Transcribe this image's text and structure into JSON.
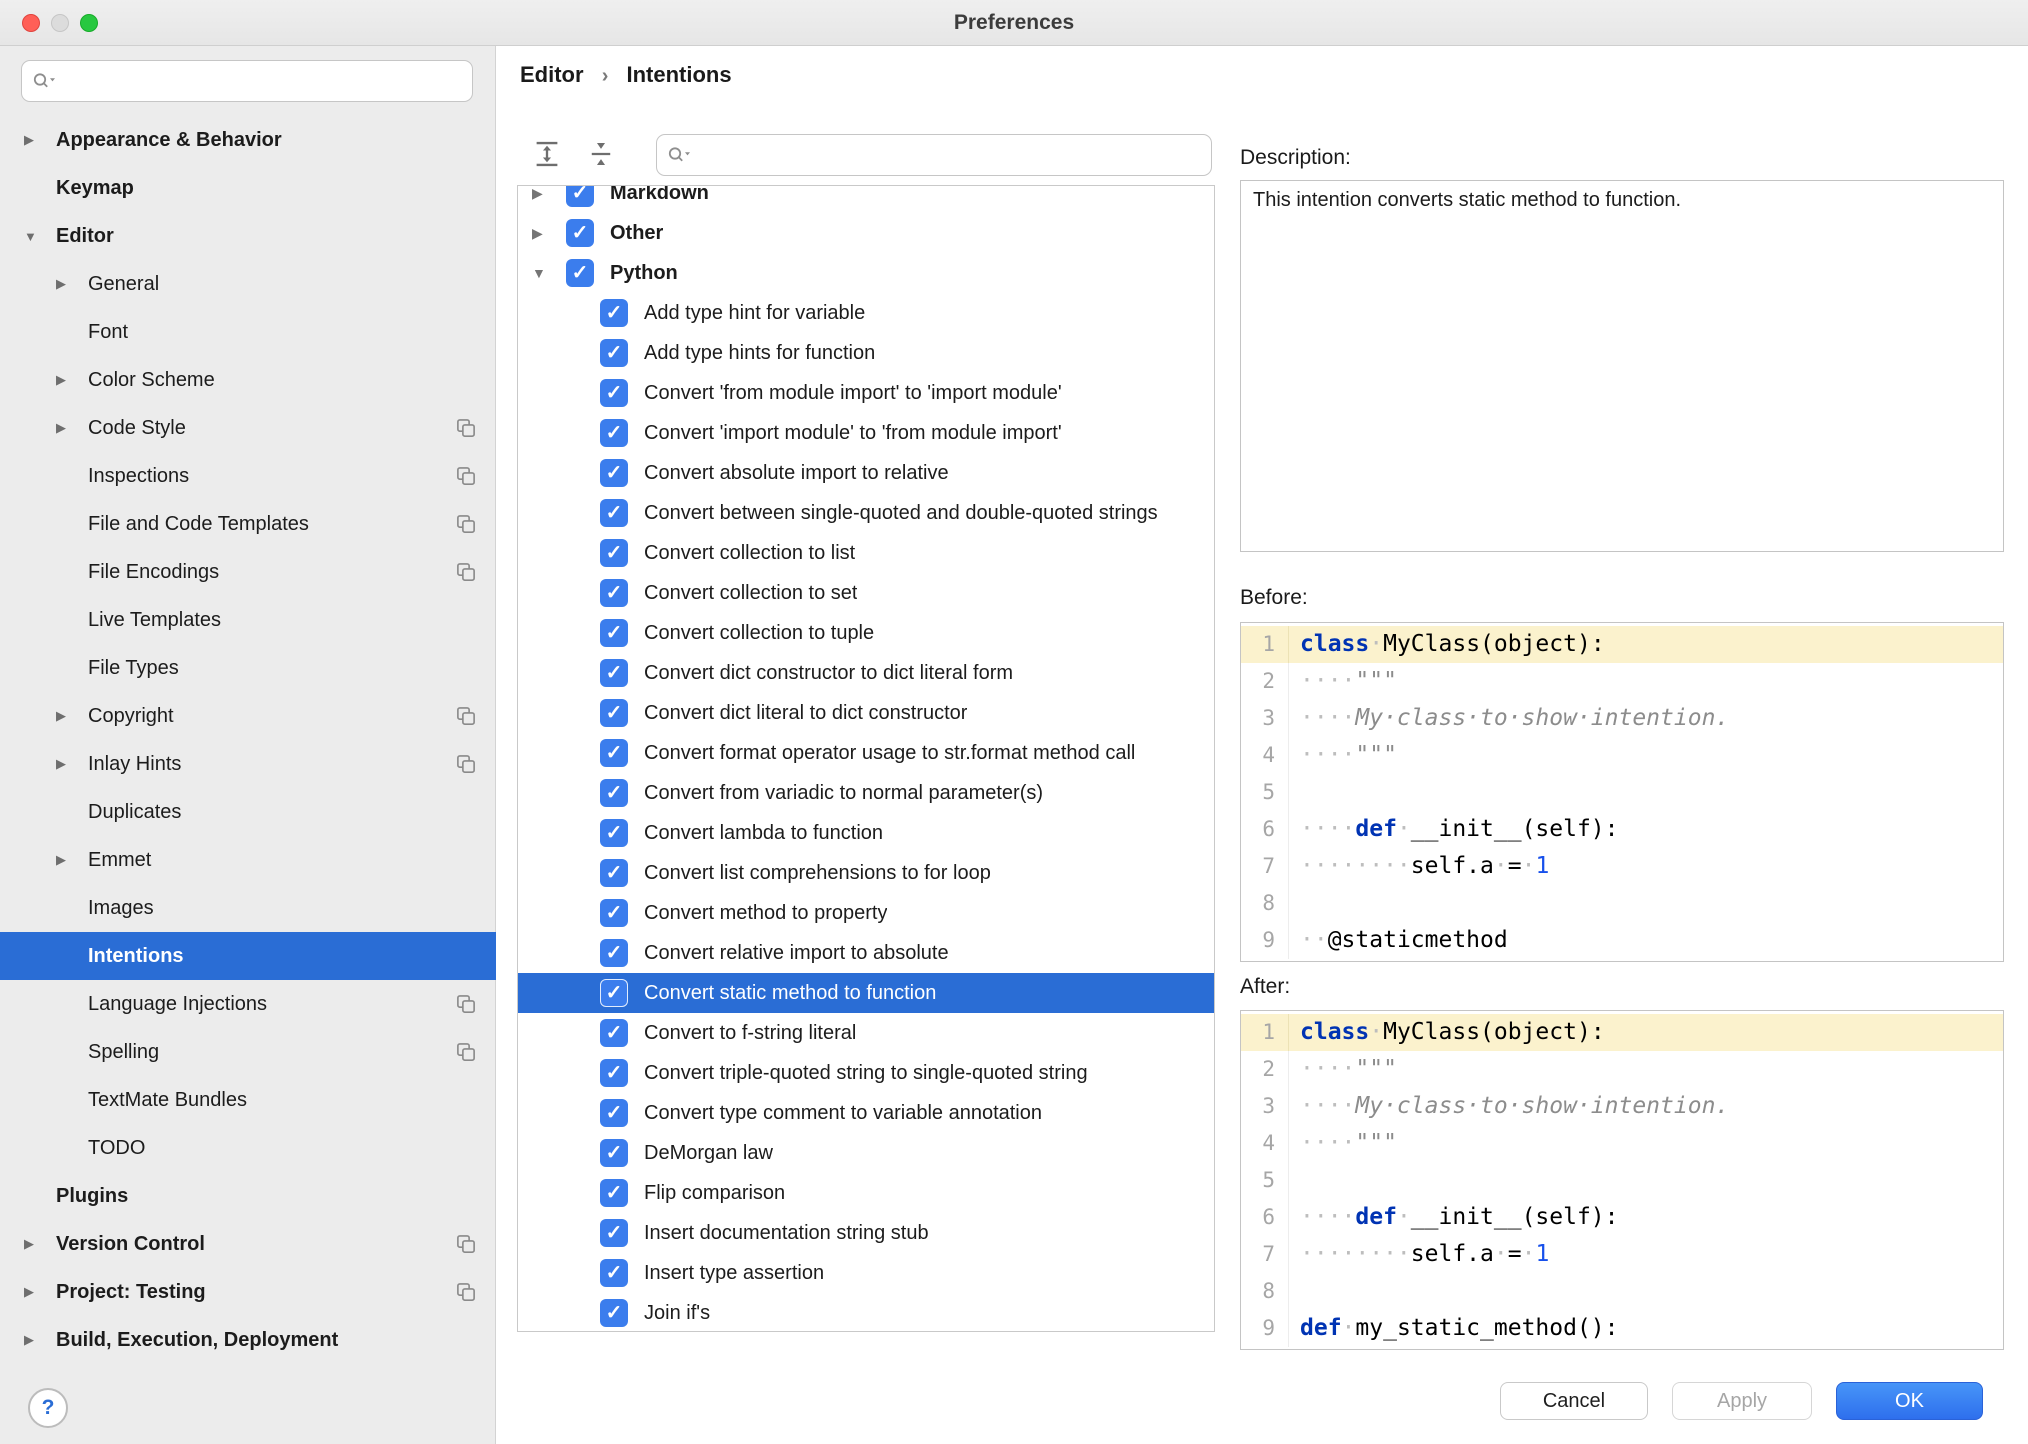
{
  "window": {
    "title": "Preferences"
  },
  "colors": {
    "selection_blue": "#2a6dd5",
    "checkbox_blue": "#3b7ded",
    "ok_button_blue": "#3574f0",
    "line_highlight_yellow": "#fbf2cd",
    "sidebar_gray": "#ececec"
  },
  "sidebar": {
    "search_placeholder": "",
    "items": [
      {
        "label": "Appearance & Behavior",
        "level": 0,
        "bold": true,
        "chevron": "right"
      },
      {
        "label": "Keymap",
        "level": 0,
        "bold": true
      },
      {
        "label": "Editor",
        "level": 0,
        "bold": true,
        "chevron": "down"
      },
      {
        "label": "General",
        "level": 1,
        "chevron": "right"
      },
      {
        "label": "Font",
        "level": 1
      },
      {
        "label": "Color Scheme",
        "level": 1,
        "chevron": "right"
      },
      {
        "label": "Code Style",
        "level": 1,
        "chevron": "right",
        "badge": true
      },
      {
        "label": "Inspections",
        "level": 1,
        "badge": true
      },
      {
        "label": "File and Code Templates",
        "level": 1,
        "badge": true
      },
      {
        "label": "File Encodings",
        "level": 1,
        "badge": true
      },
      {
        "label": "Live Templates",
        "level": 1
      },
      {
        "label": "File Types",
        "level": 1
      },
      {
        "label": "Copyright",
        "level": 1,
        "chevron": "right",
        "badge": true
      },
      {
        "label": "Inlay Hints",
        "level": 1,
        "chevron": "right",
        "badge": true
      },
      {
        "label": "Duplicates",
        "level": 1
      },
      {
        "label": "Emmet",
        "level": 1,
        "chevron": "right"
      },
      {
        "label": "Images",
        "level": 1
      },
      {
        "label": "Intentions",
        "level": 1,
        "selected": true
      },
      {
        "label": "Language Injections",
        "level": 1,
        "badge": true
      },
      {
        "label": "Spelling",
        "level": 1,
        "badge": true
      },
      {
        "label": "TextMate Bundles",
        "level": 1
      },
      {
        "label": "TODO",
        "level": 1
      },
      {
        "label": "Plugins",
        "level": 0,
        "bold": true
      },
      {
        "label": "Version Control",
        "level": 0,
        "bold": true,
        "chevron": "right",
        "badge": true
      },
      {
        "label": "Project: Testing",
        "level": 0,
        "bold": true,
        "chevron": "right",
        "badge": true
      },
      {
        "label": "Build, Execution, Deployment",
        "level": 0,
        "bold": true,
        "chevron": "right"
      }
    ]
  },
  "breadcrumb": {
    "parts": [
      "Editor",
      "Intentions"
    ],
    "separator": "›"
  },
  "tree_search_placeholder": "",
  "intentions_tree": {
    "rows": [
      {
        "label": "Markdown",
        "group": true,
        "chevron": "right",
        "checked": true,
        "clipped_top": true
      },
      {
        "label": "Other",
        "group": true,
        "chevron": "right",
        "checked": true
      },
      {
        "label": "Python",
        "group": true,
        "chevron": "down",
        "checked": true
      },
      {
        "label": "Add type hint for variable",
        "checked": true
      },
      {
        "label": "Add type hints for function",
        "checked": true
      },
      {
        "label": "Convert 'from module import' to 'import module'",
        "checked": true
      },
      {
        "label": "Convert 'import module' to 'from module import'",
        "checked": true
      },
      {
        "label": "Convert absolute import to relative",
        "checked": true
      },
      {
        "label": "Convert between single-quoted and double-quoted strings",
        "checked": true
      },
      {
        "label": "Convert collection to list",
        "checked": true
      },
      {
        "label": "Convert collection to set",
        "checked": true
      },
      {
        "label": "Convert collection to tuple",
        "checked": true
      },
      {
        "label": "Convert dict constructor to dict literal form",
        "checked": true
      },
      {
        "label": "Convert dict literal to dict constructor",
        "checked": true
      },
      {
        "label": "Convert format operator usage to str.format method call",
        "checked": true
      },
      {
        "label": "Convert from variadic to normal parameter(s)",
        "checked": true
      },
      {
        "label": "Convert lambda to function",
        "checked": true
      },
      {
        "label": "Convert list comprehensions to for loop",
        "checked": true
      },
      {
        "label": "Convert method to property",
        "checked": true
      },
      {
        "label": "Convert relative import to absolute",
        "checked": true
      },
      {
        "label": "Convert static method to function",
        "checked": true,
        "selected": true
      },
      {
        "label": "Convert to f-string literal",
        "checked": true
      },
      {
        "label": "Convert triple-quoted string to single-quoted string",
        "checked": true
      },
      {
        "label": "Convert type comment to variable annotation",
        "checked": true
      },
      {
        "label": "DeMorgan law",
        "checked": true
      },
      {
        "label": "Flip comparison",
        "checked": true
      },
      {
        "label": "Insert documentation string stub",
        "checked": true
      },
      {
        "label": "Insert type assertion",
        "checked": true
      },
      {
        "label": "Join if's",
        "checked": true
      }
    ]
  },
  "description": {
    "label": "Description:",
    "text": "This intention converts static method to function."
  },
  "before": {
    "label": "Before:",
    "lines": [
      {
        "n": "1",
        "hl": true,
        "segs": [
          {
            "c": "kw",
            "t": "class"
          },
          {
            "c": "ws",
            "t": "·"
          },
          {
            "c": "pl",
            "t": "MyClass(object):"
          }
        ]
      },
      {
        "n": "2",
        "segs": [
          {
            "c": "ws",
            "t": "····"
          },
          {
            "c": "doc",
            "t": "\"\"\""
          }
        ]
      },
      {
        "n": "3",
        "segs": [
          {
            "c": "ws",
            "t": "····"
          },
          {
            "c": "doc",
            "t": "My·class·to·show·intention."
          }
        ]
      },
      {
        "n": "4",
        "segs": [
          {
            "c": "ws",
            "t": "····"
          },
          {
            "c": "doc",
            "t": "\"\"\""
          }
        ]
      },
      {
        "n": "5",
        "segs": []
      },
      {
        "n": "6",
        "segs": [
          {
            "c": "ws",
            "t": "····"
          },
          {
            "c": "kw",
            "t": "def"
          },
          {
            "c": "ws",
            "t": "·"
          },
          {
            "c": "pl",
            "t": "__init__(self):"
          }
        ]
      },
      {
        "n": "7",
        "segs": [
          {
            "c": "ws",
            "t": "········"
          },
          {
            "c": "pl",
            "t": "self.a"
          },
          {
            "c": "ws",
            "t": "·"
          },
          {
            "c": "pl",
            "t": "="
          },
          {
            "c": "ws",
            "t": "·"
          },
          {
            "c": "num",
            "t": "1"
          }
        ]
      },
      {
        "n": "8",
        "segs": []
      },
      {
        "n": "9",
        "segs": [
          {
            "c": "ws",
            "t": "··"
          },
          {
            "c": "pl",
            "t": "@staticmethod"
          }
        ]
      }
    ]
  },
  "after": {
    "label": "After:",
    "lines": [
      {
        "n": "1",
        "hl": true,
        "segs": [
          {
            "c": "kw",
            "t": "class"
          },
          {
            "c": "ws",
            "t": "·"
          },
          {
            "c": "pl",
            "t": "MyClass(object):"
          }
        ]
      },
      {
        "n": "2",
        "segs": [
          {
            "c": "ws",
            "t": "····"
          },
          {
            "c": "doc",
            "t": "\"\"\""
          }
        ]
      },
      {
        "n": "3",
        "segs": [
          {
            "c": "ws",
            "t": "····"
          },
          {
            "c": "doc",
            "t": "My·class·to·show·intention."
          }
        ]
      },
      {
        "n": "4",
        "segs": [
          {
            "c": "ws",
            "t": "····"
          },
          {
            "c": "doc",
            "t": "\"\"\""
          }
        ]
      },
      {
        "n": "5",
        "segs": []
      },
      {
        "n": "6",
        "segs": [
          {
            "c": "ws",
            "t": "····"
          },
          {
            "c": "kw",
            "t": "def"
          },
          {
            "c": "ws",
            "t": "·"
          },
          {
            "c": "pl",
            "t": "__init__(self):"
          }
        ]
      },
      {
        "n": "7",
        "segs": [
          {
            "c": "ws",
            "t": "········"
          },
          {
            "c": "pl",
            "t": "self.a"
          },
          {
            "c": "ws",
            "t": "·"
          },
          {
            "c": "pl",
            "t": "="
          },
          {
            "c": "ws",
            "t": "·"
          },
          {
            "c": "num",
            "t": "1"
          }
        ]
      },
      {
        "n": "8",
        "segs": []
      },
      {
        "n": "9",
        "segs": [
          {
            "c": "kw",
            "t": "def"
          },
          {
            "c": "ws",
            "t": "·"
          },
          {
            "c": "pl",
            "t": "my_static_method():"
          }
        ]
      }
    ]
  },
  "buttons": {
    "cancel": "Cancel",
    "apply": "Apply",
    "ok": "OK"
  },
  "help": {
    "label": "?"
  }
}
